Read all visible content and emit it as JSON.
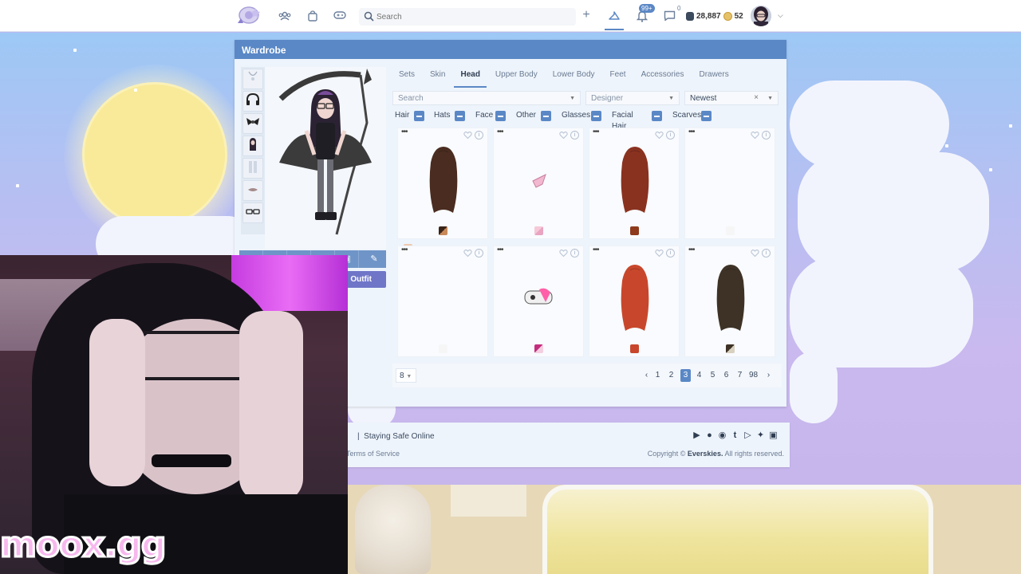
{
  "topbar": {
    "search_placeholder": "Search",
    "notifications_badge": "99+",
    "messages_count": "0",
    "currency_dark": "28,887",
    "currency_gold": "52"
  },
  "wardrobe": {
    "title": "Wardrobe",
    "tabs": [
      "Sets",
      "Skin",
      "Head",
      "Upper Body",
      "Lower Body",
      "Feet",
      "Accessories",
      "Drawers"
    ],
    "active_tab": "Head",
    "filters": {
      "search_placeholder": "Search",
      "designer_placeholder": "Designer",
      "sort_value": "Newest"
    },
    "categories": [
      "Hair",
      "Hats",
      "Face",
      "Other",
      "Glasses",
      "Facial Hair",
      "Scarves"
    ],
    "save_outfit_label": "d Outfit",
    "items": [
      {
        "type": "hair",
        "color": "#4a2c20",
        "swatch": [
          "#3a2418",
          "#c98a5a"
        ]
      },
      {
        "type": "bow",
        "color": "#f2b8cf",
        "swatch": [
          "#f6c8d8",
          "#e8a4c0"
        ]
      },
      {
        "type": "hair",
        "color": "#8a3220",
        "swatch": [
          "#8e3a1c",
          "#8e3a1c"
        ]
      },
      {
        "type": "empty",
        "color": "",
        "swatch": [
          "#f6f6f6",
          "#f6f6f6"
        ]
      },
      {
        "type": "empty",
        "color": "",
        "swatch": [
          "#f6f6f6",
          "#f6f6f6"
        ]
      },
      {
        "type": "mask",
        "color": "#ff5fa8",
        "swatch": [
          "#c42e7e",
          "#f4cfe0"
        ]
      },
      {
        "type": "hair",
        "color": "#c8472c",
        "swatch": [
          "#c8472c",
          "#c8472c"
        ]
      },
      {
        "type": "hair",
        "color": "#3e3226",
        "swatch": [
          "#3e3226",
          "#d8d0c0"
        ]
      }
    ],
    "pager": {
      "per_page": "8",
      "pages": [
        "1",
        "2",
        "3",
        "4",
        "5",
        "6",
        "7",
        "98"
      ],
      "current": "3"
    }
  },
  "footer": {
    "links_line": "Staying Safe Online",
    "sep": "|",
    "terms": "Terms of Service",
    "copyright_prefix": "Copyright ©",
    "copyright_brand": "Everskies.",
    "copyright_suffix": "All rights reserved.",
    "social_icons": [
      "google-play-icon",
      "apple-icon",
      "instagram-icon",
      "tumblr-icon",
      "youtube-icon",
      "twitter-icon",
      "discord-icon"
    ]
  },
  "stream": {
    "watermark": "moox.gg"
  },
  "colors": {
    "accent": "#5a88c6",
    "save_button": "#6f76c8",
    "panel_bg": "#eef4fb"
  }
}
